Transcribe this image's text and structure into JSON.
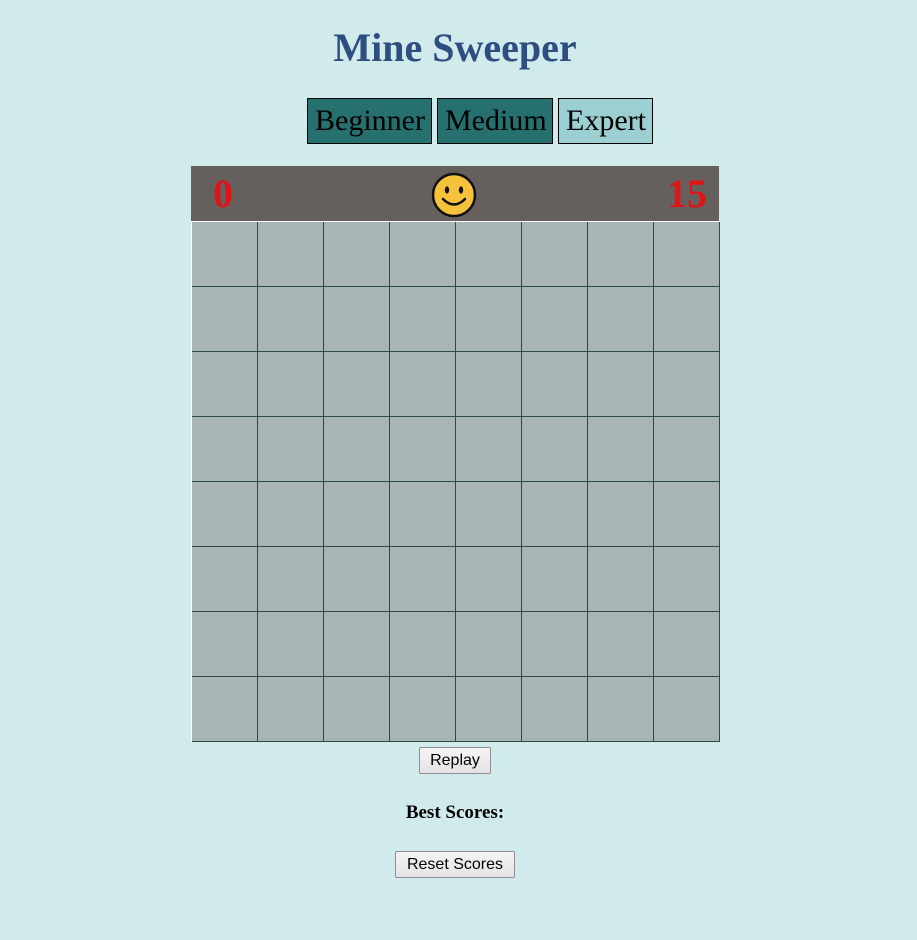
{
  "title": "Mine Sweeper",
  "levels": {
    "beginner": "Beginner",
    "medium": "Medium",
    "expert": "Expert",
    "selected": "Expert"
  },
  "board": {
    "flags": "0",
    "timer": "15",
    "smiley": "smiley-face-icon",
    "rows": 8,
    "cols": 8
  },
  "buttons": {
    "replay": "Replay",
    "reset_scores": "Reset Scores"
  },
  "best_scores_label": "Best Scores:",
  "colors": {
    "background": "#d1ebec",
    "title": "#2e4d80",
    "level_button": "#267070",
    "level_button_active": "#9ccfd1",
    "header": "#65605e",
    "counter": "#e01414",
    "cell": "#a9b5b5",
    "grid_line": "#2c4a4a"
  }
}
